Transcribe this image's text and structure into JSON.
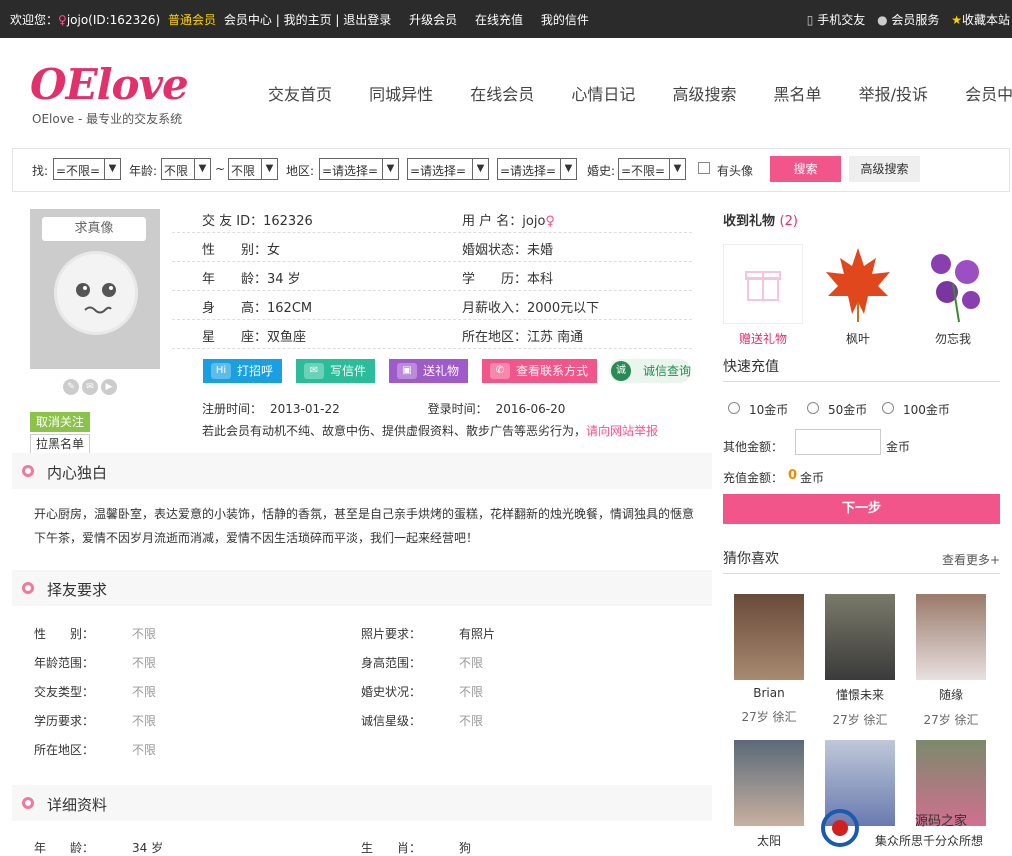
{
  "topbar": {
    "welcome": "欢迎您：",
    "username": "jojo(ID:162326)",
    "member_level": "普通会员",
    "member_center": "会员中心",
    "sep1": "|",
    "my_home": "我的主页",
    "sep2": "|",
    "logout": "退出登录",
    "upgrade": "升级会员",
    "recharge": "在线充值",
    "my_mail": "我的信件",
    "mobile": "手机交友",
    "service": "会员服务",
    "favorite": "收藏本站"
  },
  "header": {
    "logo_text": "OElove",
    "slogan": "OElove - 最专业的交友系统",
    "nav": [
      "交友首页",
      "同城异性",
      "在线会员",
      "心情日记",
      "高级搜索",
      "黑名单",
      "举报/投诉",
      "会员中心"
    ]
  },
  "search": {
    "find_label": "找:",
    "gender_value": "=不限=",
    "age_label": "年龄:",
    "age_from": "不限",
    "tilde": "~",
    "age_to": "不限",
    "area_label": "地区:",
    "area1": "=请选择=",
    "area2": "=请选择=",
    "area3": "=请选择=",
    "marriage_label": "婚史:",
    "marriage_value": "=不限=",
    "has_photo_label": "有头像",
    "search_button": "搜索",
    "advanced_button": "高级搜索"
  },
  "profile": {
    "avatar_label": "求真像",
    "unfollow": "取消关注",
    "block": "拉黑名单",
    "rows": [
      {
        "k1": "交 友 ID：162326",
        "k2": "用 户 名：jojo"
      },
      {
        "k1": "性　　别：女",
        "k2": "婚姻状态：未婚"
      },
      {
        "k1": "年　　龄：34 岁",
        "k2": "学　　历：本科"
      },
      {
        "k1": "身　　高：162CM",
        "k2": "月薪收入：2000元以下"
      },
      {
        "k1": "星　　座：双鱼座",
        "k2": "所在地区：江苏 南通"
      }
    ],
    "actions": [
      "打招呼",
      "写信件",
      "送礼物",
      "查看联系方式",
      "诚信查询"
    ],
    "reg_label": "注册时间：",
    "reg_time": "2013-01-22",
    "login_label": "登录时间：",
    "login_time": "2016-06-20",
    "warn_text": "若此会员有动机不纯、故意中伤、提供虚假资料、散步广告等恶劣行为，",
    "report_link": "请向网站举报"
  },
  "monologue": {
    "title": "内心独白",
    "text": "开心厨房，温馨卧室，表达爱意的小装饰，恬静的香氛，甚至是自己亲手烘烤的蛋糕，花样翻新的烛光晚餐，情调独具的惬意下午茶，爱情不因岁月流逝而消减，爱情不因生活琐碎而平淡，我们一起来经营吧！"
  },
  "requirements": {
    "title": "择友要求",
    "left": [
      {
        "k": "性　　别：",
        "v": "不限"
      },
      {
        "k": "年龄范围：",
        "v": "不限"
      },
      {
        "k": "交友类型：",
        "v": "不限"
      },
      {
        "k": "学历要求：",
        "v": "不限"
      },
      {
        "k": "所在地区：",
        "v": "不限"
      }
    ],
    "right": [
      {
        "k": "照片要求：",
        "v": "有照片"
      },
      {
        "k": "身高范围：",
        "v": "不限"
      },
      {
        "k": "婚史状况：",
        "v": "不限"
      },
      {
        "k": "诚信星级：",
        "v": "不限"
      }
    ]
  },
  "details": {
    "title": "详细资料",
    "left": {
      "k": "年　　龄：",
      "v": "34 岁"
    },
    "right": {
      "k": "生　　肖：",
      "v": "狗"
    }
  },
  "sidebar": {
    "gifts_title": "收到礼物",
    "gifts_count": "(2)",
    "gifts": [
      {
        "label": "赠送礼物"
      },
      {
        "label": "枫叶"
      },
      {
        "label": "勿忘我"
      }
    ],
    "quick_title": "快速充值",
    "options": [
      "10金币",
      "50金币",
      "100金币"
    ],
    "other_label": "其他金额：",
    "other_unit": "金币",
    "amount_label": "充值金额：",
    "amount_value": "0",
    "amount_unit": "金币",
    "next_button": "下一步",
    "guess_title": "猜你喜欢",
    "more_link": "查看更多+",
    "people": [
      {
        "name": "Brian",
        "age": "27岁",
        "city": "徐汇"
      },
      {
        "name": "懂憬未来",
        "age": "27岁",
        "city": "徐汇"
      },
      {
        "name": "随缘",
        "age": "27岁",
        "city": "徐汇"
      },
      {
        "name": "太阳",
        "age": "",
        "city": ""
      },
      {
        "name": "",
        "age": "",
        "city": ""
      },
      {
        "name": "",
        "age": "",
        "city": ""
      }
    ]
  },
  "watermark": {
    "line1": "源码之家",
    "line2": "集众所思千分众所想"
  },
  "colors": {
    "accent": "#f2558a",
    "topbar": "#2b2b2b",
    "green": "#8bc34a"
  }
}
